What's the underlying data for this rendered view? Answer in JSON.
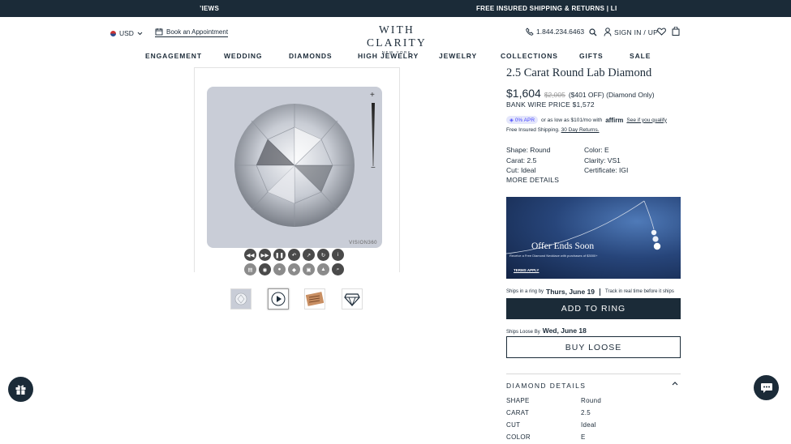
{
  "announcement": {
    "left_text": "’IEWS",
    "center_text": "FREE INSURED SHIPPING & RETURNS | LI"
  },
  "header": {
    "currency": "USD",
    "book_appointment": "Book an Appointment",
    "logo_main": "WITH CLARITY",
    "logo_sub": "NEW YORK",
    "phone": "1.844.234.6463",
    "sign_in": "SIGN IN / UP"
  },
  "nav": [
    "ENGAGEMENT",
    "WEDDING",
    "DIAMONDS",
    "HIGH JEWELRY",
    "JEWELRY",
    "COLLECTIONS",
    "GIFTS",
    "SALE"
  ],
  "viewer": {
    "watermark": "VISION360",
    "controls_row1": [
      "rewind-icon",
      "fast-forward-icon",
      "pause-icon",
      "rotate-left-icon",
      "rotate-right-icon",
      "reset-icon",
      "info-icon"
    ],
    "controls_row2": [
      "view-1-icon",
      "eye-icon",
      "view-3-icon",
      "view-4-icon",
      "view-5-icon",
      "view-6-icon",
      "zoom-icon"
    ],
    "thumbnails": [
      "diamond-thumb",
      "video-thumb",
      "certificate-thumb",
      "shape-thumb"
    ]
  },
  "product": {
    "title": "2.5 Carat Round Lab Diamond",
    "price": "$1,604",
    "original_price": "$2,005",
    "discount": "($401 OFF) (Diamond Only)",
    "bank_wire": "BANK WIRE PRICE $1,572",
    "apr_badge": "0% APR",
    "affirm_text": "or as low as $101/mo with",
    "affirm_brand": "affirm",
    "affirm_link": "See if you qualify",
    "shipping_text": "Free Insured Shipping.",
    "returns_link": "30 Day Returns.",
    "specs": [
      "Shape: Round",
      "Color: E",
      "Carat: 2.5",
      "Clarity: VS1",
      "Cut: Ideal",
      "Certificate: IGI"
    ],
    "more_details": "MORE DETAILS"
  },
  "banner": {
    "headline": "Offer Ends Soon",
    "subtext": "Receive a Free Diamond Necklace with purchases of $3000+",
    "terms": "TERMS APPLY"
  },
  "purchase": {
    "ship_ring_prefix": "Ships in a ring by",
    "ship_ring_date": "Thurs, June 19",
    "track_text": "Track in real time before it ships",
    "add_to_ring": "ADD TO RING",
    "ship_loose_prefix": "Ships Loose By",
    "ship_loose_date": "Wed, June 18",
    "buy_loose": "BUY LOOSE"
  },
  "diamond_details": {
    "title": "DIAMOND DETAILS",
    "rows": [
      {
        "key": "SHAPE",
        "value": "Round"
      },
      {
        "key": "CARAT",
        "value": "2.5"
      },
      {
        "key": "CUT",
        "value": "Ideal"
      },
      {
        "key": "COLOR",
        "value": "E"
      }
    ]
  },
  "colors": {
    "navy": "#1b2b38",
    "banner_blue": "#27457a",
    "apr_purple": "#4a4aff"
  }
}
